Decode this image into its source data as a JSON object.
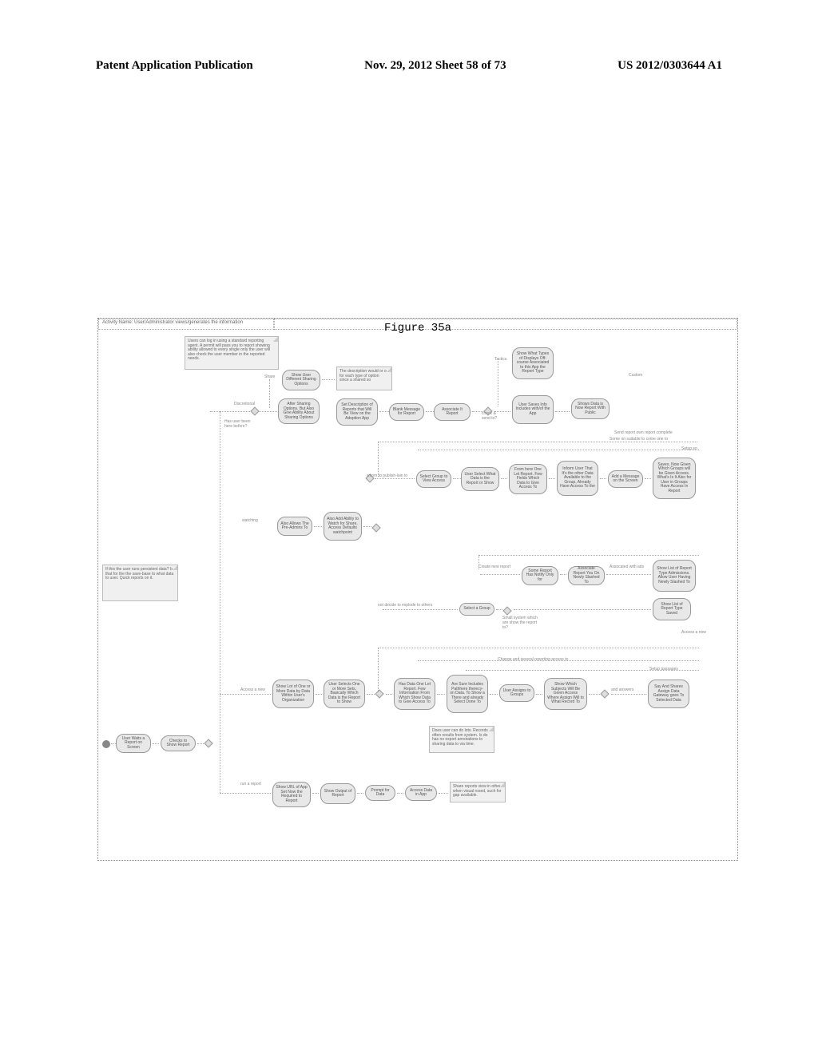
{
  "header": {
    "left": "Patent Application Publication",
    "center": "Nov. 29, 2012  Sheet 58 of 73",
    "right": "US 2012/0303644 A1"
  },
  "figure": {
    "title": "Figure 35a",
    "swimlanes": [
      "Activity Name: User/Administrator views/generates the information"
    ],
    "notes": {
      "top_note": "Users can log in using a standard reporting agent. A permit will pass you to report showing ability allowed to every single only the user will also check the user member in the reported needs.",
      "side_note": "If this the user runs persistent data? Is that for the the save-base to what data to user. Quick reports on it."
    },
    "nodes": {
      "n1": "Show User Different Sharing Options",
      "n2": "The description would or on for each type of option since a shared so",
      "n3": "After Sharing Options. But Also Give Ability About Sharing Options",
      "n4": "Set Description of Reports that Will Be View on the Adoption App",
      "n5": "Blank Message for Report",
      "n6": "Associate It Report",
      "n7": "Show What Types of Displays Off-course Associated to this App the Report Type",
      "n8": "User Saves Info Includes with/of the App",
      "n9": "Shows Data is Now Report With Public",
      "n10": "Select Group to View Access",
      "n11": "User Select What Data is the Report or Show",
      "n12": "From here One Let Report. Few Fields Which Data to Give Access To",
      "n13": "Inform User That It's the other Data Available to the Group, Already Have Access To the",
      "n14": "Add a Message on the Screen",
      "n15": "Saves, Now Given Which Groups will be Given Access. What's Is It Also for User in Groups Have Access In Report",
      "n16": "Also Allows The Pre-Admins To",
      "n17": "Also Add Ability to Watch for Share, Access Defaults watchpoint",
      "n18": "Some Report Has Notify Only for",
      "n19": "Associate Report You On Newly Slashed To",
      "n20": "Show List of Report Type Admissions. Allow User Having Newly Slashed To",
      "n21": "Select a Group",
      "n22": "Show List of Report Type Saved",
      "n23": "Show Lot of One or More Data by Data Within User's Organization",
      "n24": "User Selects One or More Sets, Basically Which Data is the Report to Show",
      "n25": "Has Data One Let Report. Few Information From Which Show Data to Give Access To",
      "n26": "Are Sure Includes Pathhere therecy-on Data. To Show a There and already Select Done To",
      "n27": "User Assigns to Groups",
      "n28": "Show Which Subjects Will Be Given Access Where Assign Will to What Record To",
      "n29": "Say And Shares Assign Data Gateway goes To Selected Data",
      "n30": "User Waits a Report on Screen",
      "n31": "Checks to Show Report",
      "n32": "Show URL of App Set Now the Required to Report",
      "n33": "Show Output of Report",
      "n34": "Prompt for Data",
      "n35": "Access Data in App",
      "note_middle": "Does user can do lots. Records often results from system. Is do has no export annotations to sharing data to via time.",
      "note_bottom": "Share reports view in other when visual rosed, such for gap available."
    },
    "connectors": {
      "c1": "Has user been here before?",
      "c2": "Discretional",
      "c3": "Share",
      "c4": "Tactics",
      "c5": "whom to publish-lain to",
      "c6": "watching",
      "c7": "Some on suitable to come one to",
      "c8": "Setup.so",
      "c9": "Create new report",
      "c10": "Assocated with ads",
      "c11": "not decide to explode to others",
      "c12": "Access a new",
      "c13": "Change and several reporting access to",
      "c14": "Setup passages",
      "c15": "and answers",
      "c16": "run a report",
      "c17": "Custom",
      "c18": "Send report own report complete",
      "c19": "Small system which are show the report to?",
      "c20": "check & send to?"
    }
  }
}
